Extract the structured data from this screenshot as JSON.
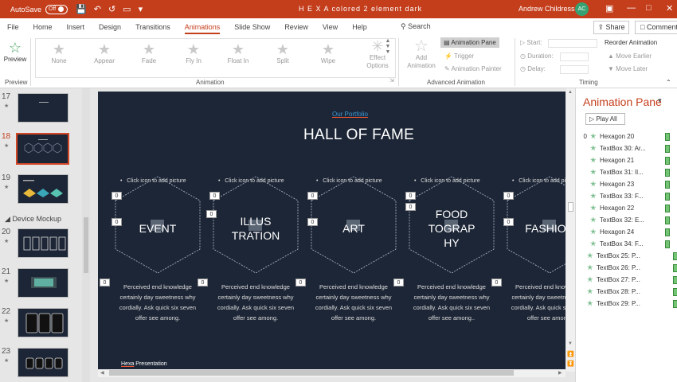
{
  "titlebar": {
    "autosave_label": "AutoSave",
    "autosave_state": "Off",
    "doc_title": "H E X A colored 2 element dark",
    "user_name": "Andrew Childress",
    "user_initials": "AC",
    "accent_color": "#c43e1c"
  },
  "menu": {
    "tabs": [
      "File",
      "Home",
      "Insert",
      "Design",
      "Transitions",
      "Animations",
      "Slide Show",
      "Review",
      "View",
      "Help"
    ],
    "active_tab": "Animations",
    "tell_me": "Search",
    "share_label": "Share",
    "comments_label": "Comments"
  },
  "ribbon": {
    "preview_label": "Preview",
    "preview_group": "Preview",
    "animations": [
      "None",
      "Appear",
      "Fade",
      "Fly In",
      "Float In",
      "Split",
      "Wipe"
    ],
    "effect_options": [
      "Effect",
      "Options"
    ],
    "animation_group": "Animation",
    "add_animation": [
      "Add",
      "Animation"
    ],
    "animation_pane": "Animation Pane",
    "trigger": "Trigger",
    "animation_painter": "Animation Painter",
    "advanced_group": "Advanced Animation",
    "start_label": "Start:",
    "duration_label": "Duration:",
    "delay_label": "Delay:",
    "reorder_label": "Reorder Animation",
    "move_earlier": "Move Earlier",
    "move_later": "Move Later",
    "timing_group": "Timing"
  },
  "thumbnails": {
    "numbers": [
      "17",
      "18",
      "19",
      "20",
      "21",
      "22",
      "23"
    ],
    "selected": "18",
    "section_label": "Device Mockup"
  },
  "slide": {
    "subtitle": "Our Portfolio",
    "title": "HALL OF FAME",
    "click_icon_text": "Click icon to add picture",
    "columns": [
      {
        "label_lines": [
          "EVENT"
        ]
      },
      {
        "label_lines": [
          "ILLUS",
          "TRATION"
        ]
      },
      {
        "label_lines": [
          "ART"
        ]
      },
      {
        "label_lines": [
          "FOOD",
          "TOGRAP",
          "HY"
        ]
      },
      {
        "label_lines": [
          "FASHION"
        ]
      }
    ],
    "description_lines": [
      "Perceived end knowledge",
      "certainly day sweetness why",
      "cordially. Ask quick six seven",
      "offer see among."
    ],
    "description_last_alt": "offer see among..",
    "animation_tag": "0",
    "footer_prefix": "Hexa",
    "footer_text": "Presentation"
  },
  "anim_pane": {
    "title": "Animation Pane",
    "play_all": "Play All",
    "first_index": "0",
    "items": [
      "Hexagon 20",
      "TextBox 30: Ar...",
      "Hexagon 21",
      "TextBox 31: Il...",
      "Hexagon 23",
      "TextBox 33: F...",
      "Hexagon 22",
      "TextBox 32: E...",
      "Hexagon 24",
      "TextBox 34: F...",
      "TextBox 25: P...",
      "TextBox 26: P...",
      "TextBox 27: P...",
      "TextBox 28: P...",
      "TextBox 29: P..."
    ]
  }
}
